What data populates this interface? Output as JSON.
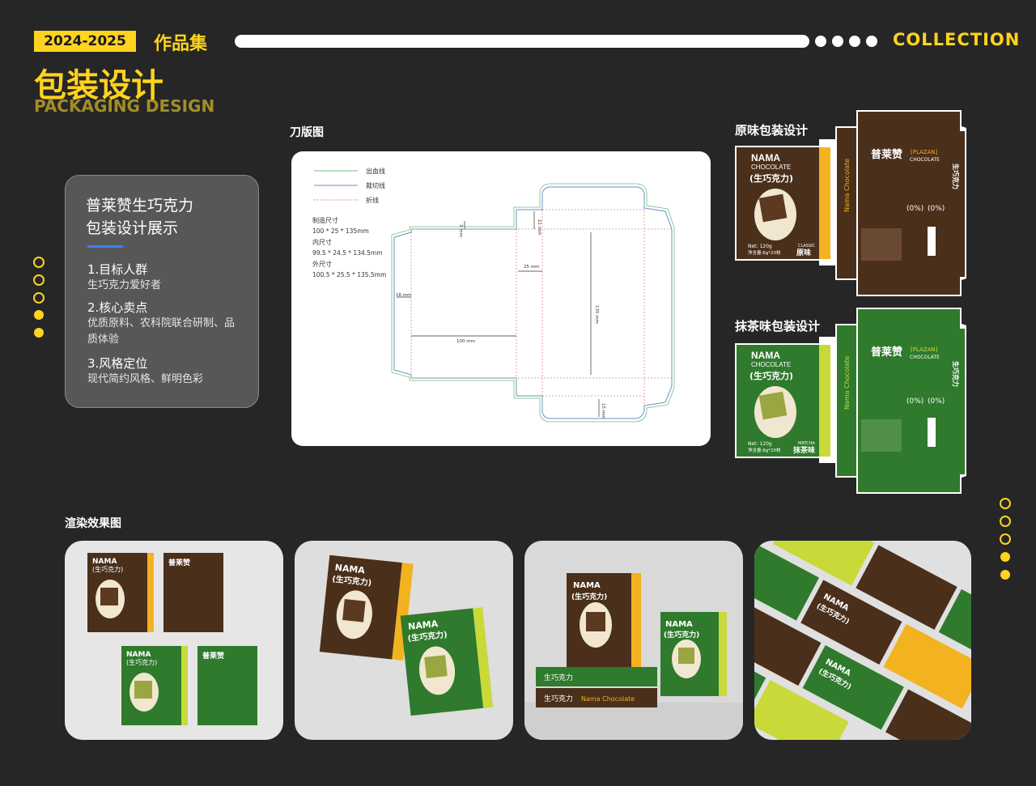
{
  "header": {
    "year_badge": "2024-2025",
    "works_label": "作品集",
    "collection": "COLLECTION"
  },
  "title": {
    "cn": "包装设计",
    "en": "PACKAGING DESIGN"
  },
  "info": {
    "title_line1": "普莱赞生巧克力",
    "title_line2": "包装设计展示",
    "sections": [
      {
        "heading": "1.目标人群",
        "body": "生巧克力爱好者"
      },
      {
        "heading": "2.核心卖点",
        "body_line1": "优质原料、农科院联合研制、品",
        "body_line2": "质体验"
      },
      {
        "heading": "3.风格定位",
        "body": "现代简约风格、鲜明色彩"
      }
    ]
  },
  "dieline": {
    "label": "刀版图",
    "legend": [
      "出血线",
      "裁切线",
      "折线"
    ],
    "legend_colors": [
      "#6fbf7a",
      "#6b8fc7",
      "#e08a8a"
    ],
    "specs": {
      "make_label": "制造尺寸",
      "make_value": "100 * 25 * 135mm",
      "inner_label": "内尺寸",
      "inner_value": "99.5 * 24.5 * 134.5mm",
      "outer_label": "外尺寸",
      "outer_value": "100.5 * 25.5 * 135.5mm"
    },
    "dims": {
      "d100": "100 mm",
      "d135": "135 mm",
      "d25": "25 mm",
      "d21": "21 mm",
      "d16": "16 mm",
      "d15": "15 mm",
      "d3": "3 mm"
    }
  },
  "packaging": {
    "classic_label": "原味包装设计",
    "matcha_label": "抹茶味包装设计",
    "brand_en": "NAMA",
    "brand_en2": "CHOCOLATE",
    "brand_cn": "(生巧克力)",
    "logo_cn": "普莱赞",
    "plazan": "[PLAZAN]",
    "plazan_sub": "CHOCOLATE",
    "side_cn": "生巧克力",
    "side_en": "Nama Chocolate",
    "net": "Net: 120g",
    "net_cn": "净含量:6g*20枚",
    "classic_en": "CLASSIC",
    "classic_cn": "原味",
    "matcha_en": "MATCHA",
    "matcha_cn": "抹茶味",
    "zero1": "(0%)",
    "zero2": "(0%)",
    "colors": {
      "classic": "#4a2f1b",
      "matcha": "#2f7a2c",
      "accent": "#f3b21f",
      "lime": "#c9d93a"
    }
  },
  "renders": {
    "label": "渲染效果图"
  }
}
